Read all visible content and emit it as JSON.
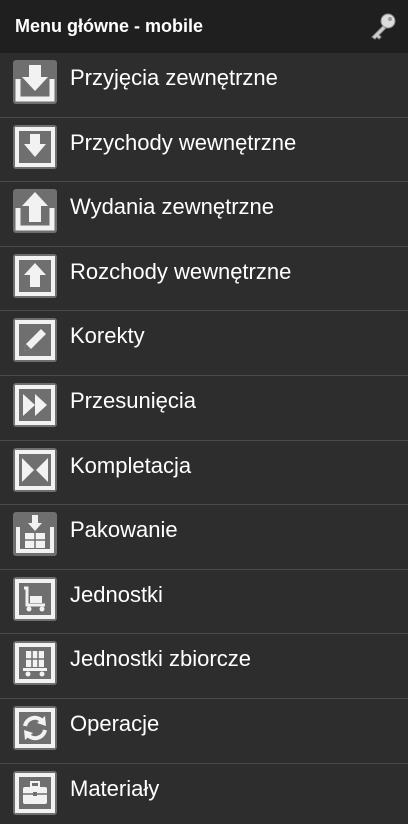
{
  "header": {
    "title": "Menu główne - mobile",
    "action_icon": "key-icon"
  },
  "menu": {
    "items": [
      {
        "label": "Przyjęcia zewnętrzne",
        "icon": "inbound-external-icon"
      },
      {
        "label": "Przychody wewnętrzne",
        "icon": "inbound-internal-icon"
      },
      {
        "label": "Wydania zewnętrzne",
        "icon": "outbound-external-icon"
      },
      {
        "label": "Rozchody wewnętrzne",
        "icon": "outbound-internal-icon"
      },
      {
        "label": "Korekty",
        "icon": "pencil-icon"
      },
      {
        "label": "Przesunięcia",
        "icon": "fast-forward-icon"
      },
      {
        "label": "Kompletacja",
        "icon": "bowtie-icon"
      },
      {
        "label": "Pakowanie",
        "icon": "box-download-icon"
      },
      {
        "label": "Jednostki",
        "icon": "hand-truck-icon"
      },
      {
        "label": "Jednostki zbiorcze",
        "icon": "pallet-cart-icon"
      },
      {
        "label": "Operacje",
        "icon": "refresh-icon"
      },
      {
        "label": "Materiały",
        "icon": "briefcase-icon"
      }
    ]
  }
}
